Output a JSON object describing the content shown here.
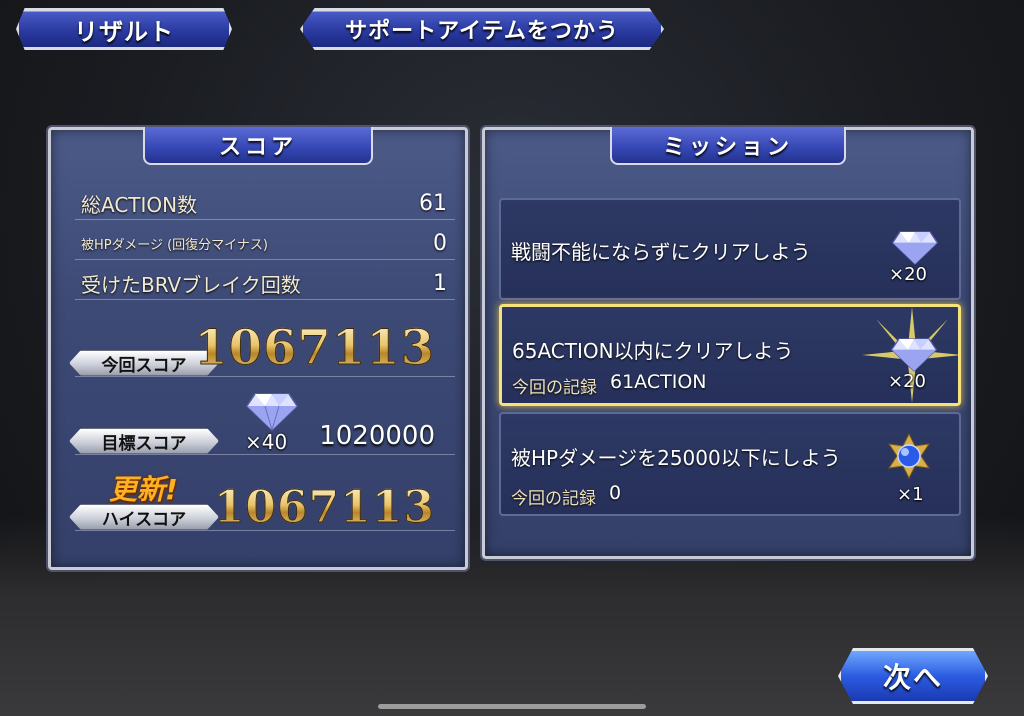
{
  "top": {
    "result_label": "リザルト",
    "support_label": "サポートアイテムをつかう"
  },
  "score_panel": {
    "title": "スコア",
    "rows": [
      {
        "label": "総ACTION数",
        "value": "61"
      },
      {
        "label": "被HPダメージ (回復分マイナス)",
        "value": "0"
      },
      {
        "label": "受けたBRVブレイク回数",
        "value": "1"
      }
    ],
    "current_label": "今回スコア",
    "current_value": "1067113",
    "target_label": "目標スコア",
    "target_gem_count": "×40",
    "target_value": "1020000",
    "updated_label": "更新!",
    "high_label": "ハイスコア",
    "high_value": "1067113"
  },
  "mission_panel": {
    "title": "ミッション",
    "missions": [
      {
        "text": "戦闘不能にならずにクリアしよう",
        "reward": "×20",
        "reward_icon": "crystal-gem-icon"
      },
      {
        "text": "65ACTION以内にクリアしよう",
        "record_label": "今回の記録",
        "record_value": "61ACTION",
        "reward": "×20",
        "reward_icon": "crystal-gem-icon"
      },
      {
        "text": "被HPダメージを25000以下にしよう",
        "record_label": "今回の記録",
        "record_value": "0",
        "reward": "×1",
        "reward_icon": "blue-orb-medal-icon"
      }
    ]
  },
  "next_label": "次へ"
}
